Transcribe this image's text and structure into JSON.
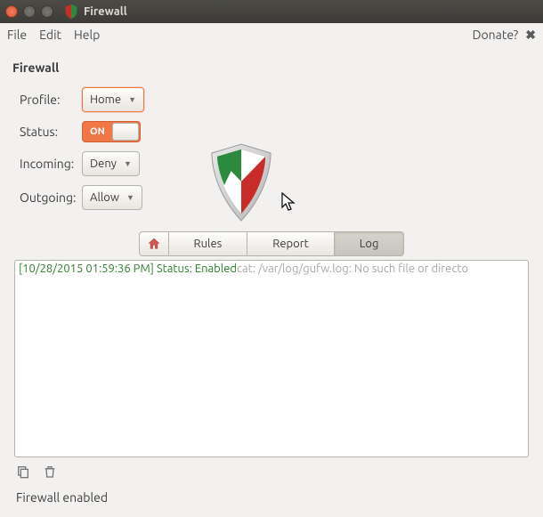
{
  "window": {
    "title": "Firewall"
  },
  "menubar": {
    "file": "File",
    "edit": "Edit",
    "help": "Help",
    "donate": "Donate?"
  },
  "page": {
    "heading": "Firewall",
    "profile_label": "Profile:",
    "profile_value": "Home",
    "status_label": "Status:",
    "status_value": "ON",
    "status_on": true,
    "incoming_label": "Incoming:",
    "incoming_value": "Deny",
    "outgoing_label": "Outgoing:",
    "outgoing_value": "Allow"
  },
  "tabs": {
    "rules": "Rules",
    "report": "Report",
    "log": "Log",
    "active": "log"
  },
  "log": {
    "timestamp": "[10/28/2015 01:59:36 PM] ",
    "status_msg": "Status: Enabled",
    "error_msg": "cat: /var/log/gufw.log: No such file or directo"
  },
  "statusbar": {
    "text": "Firewall enabled"
  },
  "colors": {
    "accent": "#f07746",
    "green": "#2b8a3e",
    "red": "#c92a2a"
  }
}
